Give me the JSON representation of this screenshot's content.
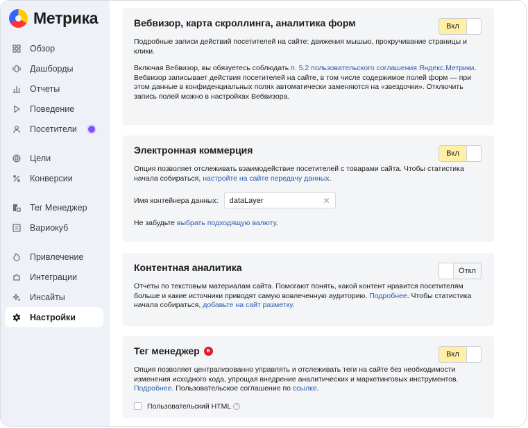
{
  "app": {
    "logo_text": "Метрика"
  },
  "sidebar": {
    "items": [
      {
        "label": "Обзор",
        "icon": "overview-icon"
      },
      {
        "label": "Дашборды",
        "icon": "dashboards-icon"
      },
      {
        "label": "Отчеты",
        "icon": "reports-icon"
      },
      {
        "label": "Поведение",
        "icon": "play-icon"
      },
      {
        "label": "Посетители",
        "icon": "user-icon"
      },
      {
        "label": "Цели",
        "icon": "target-icon"
      },
      {
        "label": "Конверсии",
        "icon": "percent-icon"
      },
      {
        "label": "Тег Менеджер",
        "icon": "tag-manager-icon"
      },
      {
        "label": "Вариокуб",
        "icon": "variocube-icon"
      },
      {
        "label": "Привлечение",
        "icon": "fire-icon"
      },
      {
        "label": "Интеграции",
        "icon": "puzzle-icon"
      },
      {
        "label": "Инсайты",
        "icon": "sparkle-icon"
      },
      {
        "label": "Настройки",
        "icon": "gear-icon"
      }
    ],
    "active": "Настройки",
    "accent": "#7b55f4"
  },
  "webvisor": {
    "title": "Вебвизор, карта скроллинга, аналитика форм",
    "toggle": "Вкл",
    "desc": "Подробные записи действий посетителей на сайте: движения мышью, прокручивание страницы и клики.",
    "p2_before": "Включая Вебвизор, вы обязуетесь соблюдать ",
    "p2_link": "п. 5.2 пользовательского соглашения Яндекс.Метрики",
    "p2_after": ". Вебвизор записывает действия посетителей на сайте, в том числе содержимое полей форм — при этом данные в конфиденциальных полях автоматически заменяются на «звездочки». Отключить запись полей можно в настройках Вебвизора."
  },
  "ecommerce": {
    "title": "Электронная коммерция",
    "toggle": "Вкл",
    "desc_before": "Опция позволяет отслеживать взаимодействие посетителей с товарами сайта. Чтобы статистика начала собираться, ",
    "desc_link": "настройте на сайте передачу данных",
    "desc_after": ".",
    "field_label": "Имя контейнера данных:",
    "field_value": "dataLayer",
    "note_before": "Не забудьте ",
    "note_link": "выбрать подходящую валюту",
    "note_after": "."
  },
  "content": {
    "title": "Контентная аналитика",
    "toggle": "Откл",
    "desc_before": "Отчеты по текстовым материалам сайта. Помогают понять, какой контент нравится посетителям больше и какие источники приводят самую вовлеченную аудиторию. ",
    "desc_link1": "Подробнее",
    "desc_mid": ". Чтобы статистика начала собираться, ",
    "desc_link2": "добавьте на сайт разметку",
    "desc_after": "."
  },
  "tagmanager": {
    "title": "Тег менеджер",
    "badge": "Б",
    "toggle": "Вкл",
    "desc_before": "Опция позволяет централизованно управлять и отслеживать теги на сайте без необходимости изменения исходного кода, упрощая внедрение аналитических и маркетинговых инструментов. ",
    "desc_link1": "Подробнее",
    "desc_mid": ". Пользовательское соглашение по ",
    "desc_link2": "ссылке",
    "desc_after": ".",
    "checkbox_label": "Пользовательский HTML",
    "help": "?"
  }
}
